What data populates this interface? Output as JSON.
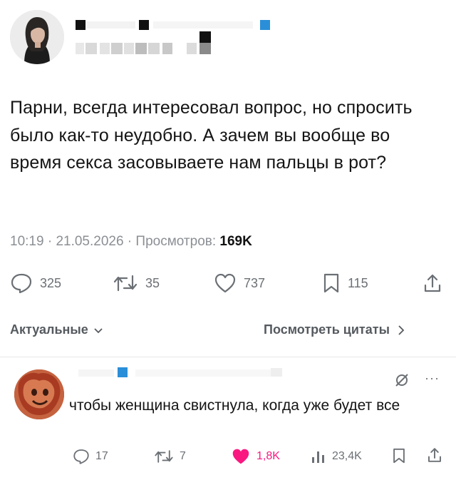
{
  "tweet": {
    "text": "Парни, всегда интересовал вопрос, но спросить было как-то неудобно. А зачем вы вообще во время секса засовываете нам пальцы в рот?",
    "time": "10:19",
    "date": "21.05.2026",
    "views_label": "Просмотров:",
    "views_value": "169K",
    "separator": " · "
  },
  "actions": {
    "replies": "325",
    "retweets": "35",
    "likes": "737",
    "bookmarks": "115"
  },
  "bar": {
    "sort_label": "Актуальные",
    "quotes_label": "Посмотреть цитаты"
  },
  "reply": {
    "text": "чтобы женщина свистнула, когда уже будет все",
    "more": "···",
    "replies": "17",
    "retweets": "7",
    "likes": "1,8K",
    "views": "23,4K"
  },
  "colors": {
    "like_active": "#f91880",
    "icon_gray": "#6b7075",
    "censor_blue": "#2a8fd8"
  },
  "icons": [
    "reply-icon",
    "retweet-icon",
    "heart-icon",
    "bookmark-icon",
    "share-icon",
    "analytics-icon",
    "grok-icon"
  ]
}
